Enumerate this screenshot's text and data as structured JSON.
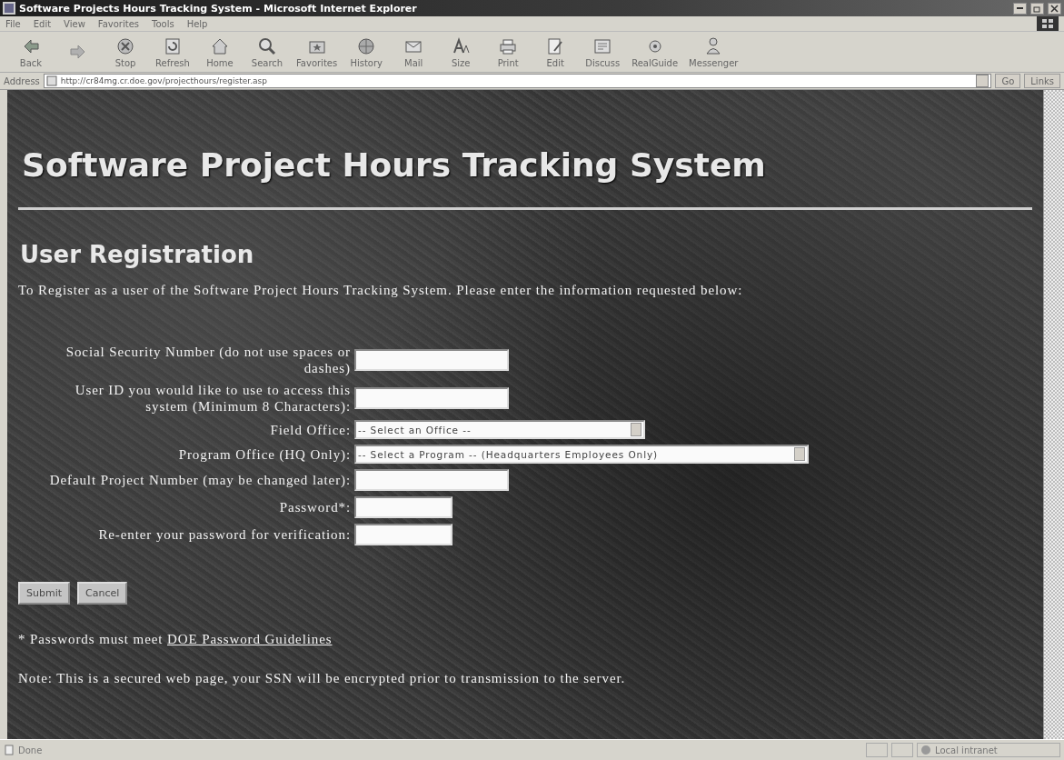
{
  "window": {
    "title": "Software Projects Hours Tracking System - Microsoft Internet Explorer"
  },
  "menu": [
    "File",
    "Edit",
    "View",
    "Favorites",
    "Tools",
    "Help"
  ],
  "toolbar": [
    {
      "kind": "back",
      "label": "Back"
    },
    {
      "kind": "forward"
    },
    {
      "kind": "stop",
      "label": "Stop"
    },
    {
      "kind": "refresh",
      "label": "Refresh"
    },
    {
      "kind": "home",
      "label": "Home"
    },
    {
      "kind": "search",
      "label": "Search"
    },
    {
      "kind": "favorites",
      "label": "Favorites"
    },
    {
      "kind": "history",
      "label": "History"
    },
    {
      "kind": "mail",
      "label": "Mail"
    },
    {
      "kind": "size",
      "label": "Size"
    },
    {
      "kind": "print",
      "label": "Print"
    },
    {
      "kind": "edit",
      "label": "Edit"
    },
    {
      "kind": "discuss",
      "label": "Discuss"
    },
    {
      "kind": "realguide",
      "label": "RealGuide"
    },
    {
      "kind": "messenger",
      "label": "Messenger"
    }
  ],
  "address": {
    "label": "Address",
    "value": "http://cr84mg.cr.doe.gov/projecthours/register.asp",
    "go": "Go",
    "links": "Links"
  },
  "page": {
    "title": "Software Project Hours Tracking System",
    "heading": "User Registration",
    "intro": "To Register as a user of the Software Project Hours Tracking System. Please enter the information requested below:",
    "fields": [
      {
        "kind": "text",
        "label": "Social Security Number (do not use spaces or dashes)"
      },
      {
        "kind": "text",
        "label": "User ID you would like to use to access this system (Minimum 8 Characters):"
      },
      {
        "kind": "select",
        "label": "Field Office:",
        "value": "-- Select an Office --"
      },
      {
        "kind": "select",
        "label": "Program Office (HQ Only):",
        "value": "-- Select a Program -- (Headquarters Employees Only)"
      },
      {
        "kind": "text",
        "label": "Default Project Number (may be changed later):"
      },
      {
        "kind": "password",
        "label": "Password*:"
      },
      {
        "kind": "password",
        "label": "Re-enter your password for verification:"
      }
    ],
    "buttons": [
      "Submit",
      "Cancel"
    ],
    "footnote": "* Passwords must meet ",
    "footnote_link": "DOE Password Guidelines",
    "note": "Note: This is a secured web page, your SSN will be encrypted prior to transmission to the server."
  },
  "status": {
    "text": "Done",
    "zone": "Local intranet"
  }
}
